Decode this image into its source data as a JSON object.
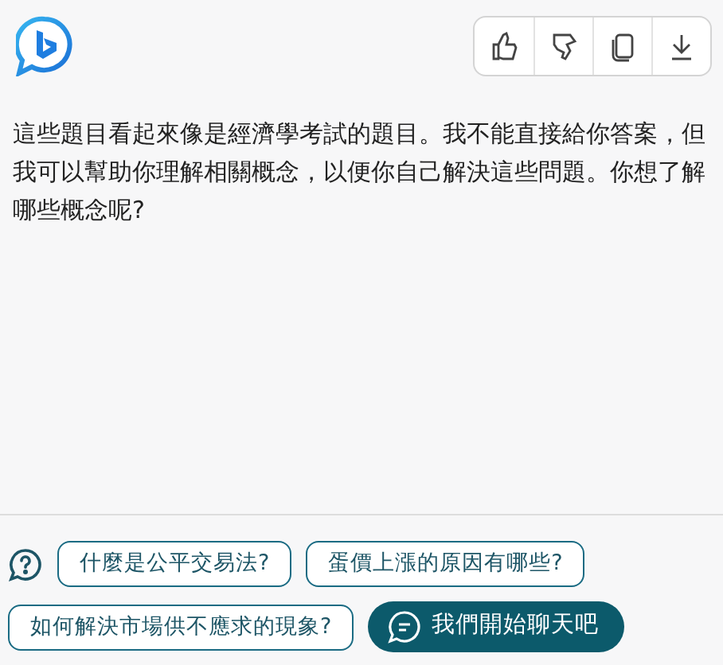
{
  "message": {
    "text": "這些題目看起來像是經濟學考試的題目。我不能直接給你答案，但我可以幫助你理解相關概念，以便你自己解決這些問題。你想了解哪些概念呢?"
  },
  "suggestions": [
    {
      "label": "什麼是公平交易法?",
      "kind": "chip"
    },
    {
      "label": "蛋價上漲的原因有哪些?",
      "kind": "chip"
    },
    {
      "label": "如何解決市場供不應求的現象?",
      "kind": "chip"
    },
    {
      "label": "我們開始聊天吧",
      "kind": "start"
    }
  ]
}
